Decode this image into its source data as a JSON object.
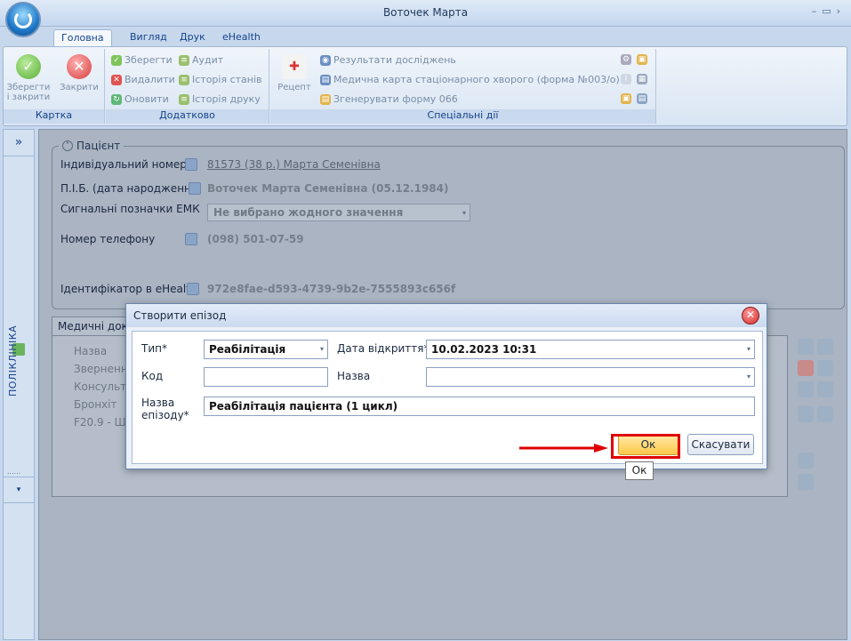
{
  "window": {
    "title": "Воточек Марта"
  },
  "tabs": [
    {
      "label": "Головна"
    },
    {
      "label": "Вигляд"
    },
    {
      "label": "Друк"
    },
    {
      "label": "eHealth"
    }
  ],
  "ribbon": {
    "card": {
      "label": "Картка",
      "save_close": "Зберегти і закрити",
      "close": "Закрити"
    },
    "extra": {
      "label": "Додатково",
      "save": "Зберегти",
      "delete": "Видалити",
      "refresh": "Оновити",
      "audit": "Аудит",
      "history_states": "Історія станів",
      "history_print": "Історія друку"
    },
    "special": {
      "label": "Спеціальні дії",
      "recipe": "Рецепт",
      "results": "Результати досліджень",
      "med_card": "Медична карта стаціонарного хворого (форма №003/о)",
      "generate": "Згенерувати форму 066"
    }
  },
  "sidebar": {
    "label": "ПОЛІКЛІНІКА",
    "expand": "»",
    "dots": "......"
  },
  "patient": {
    "legend": "Пацієнт",
    "id_label": "Індивідуальний номер",
    "id_value": "81573 (38 р.) Марта Семенівна",
    "name_label": "П.І.Б. (дата народження)",
    "name_value": "Воточек Марта Семенівна (05.12.1984)",
    "emk_label": "Сигнальні позначки ЕМК",
    "emk_value": "Не вибрано жодного значення",
    "phone_label": "Номер телефону",
    "phone_value": "(098) 501-07-59",
    "ehealth_label": "Ідентифікатор в eHealth",
    "ehealth_value": "972e8fae-d593-4739-9b2e-7555893c656f"
  },
  "docs": {
    "tab": "Медичні документи",
    "header": "Назва",
    "rows": [
      "Звернення",
      "Консультація",
      "Бронхіт",
      "F20.9 - Шизофренія"
    ]
  },
  "dialog": {
    "title": "Створити епізод",
    "type_label": "Тип*",
    "type_value": "Реабілітація",
    "date_label": "Дата відкриття*",
    "date_value": "10.02.2023 10:31",
    "code_label": "Код",
    "code_value": "",
    "name_label": "Назва",
    "name_value": "",
    "episode_label": "Назва епізоду*",
    "episode_value": "Реабілітація пацієнта (1 цикл)",
    "ok": "Ок",
    "cancel": "Скасувати",
    "tooltip": "Ок"
  }
}
